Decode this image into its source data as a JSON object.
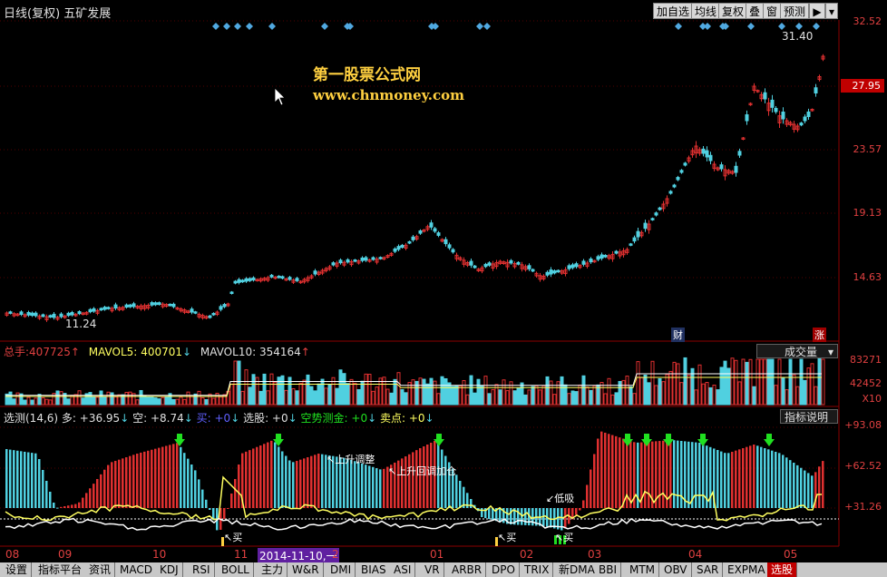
{
  "header": {
    "period_label": "日线(复权)",
    "stock_name": "五矿发展",
    "buttons": [
      "加自选",
      "均线",
      "复权",
      "叠",
      "窗",
      "预测"
    ]
  },
  "watermark": {
    "line1": "第一股票公式网",
    "line2": "www.chnmoney.com"
  },
  "main_chart": {
    "y_labels": [
      "32.52",
      "27.95",
      "23.57",
      "19.13",
      "14.63"
    ],
    "high_label": "31.40",
    "low_label": "11.24",
    "current_price_box": "27.95",
    "badge_cai": "财",
    "badge_zhang": "涨"
  },
  "volume": {
    "label_total": "总手:",
    "value_total": "407725",
    "label_mavol5": "MAVOL5:",
    "value_mavol5": "400701",
    "label_mavol10": "MAVOL10:",
    "value_mavol10": "354164",
    "dropdown": "成交量",
    "y_labels": [
      "83271",
      "42452",
      "X10"
    ]
  },
  "indicator": {
    "name": "选测(14,6)",
    "duo": "多: +36.95",
    "kong": "空: +8.74",
    "mai": "买: +0",
    "xuangu": "选股: +0",
    "kongshi": "空势测金: +0",
    "maidian": "卖点: +0",
    "explain": "指标说明",
    "y_labels": [
      "+93.08",
      "+62.52",
      "+31.26"
    ],
    "annotations": [
      "上升调整",
      "上升回调加仓",
      "低吸",
      "买",
      "买",
      "买"
    ]
  },
  "x_axis": {
    "months": [
      "08",
      "09",
      "10",
      "11",
      "01",
      "02",
      "03",
      "04",
      "05"
    ],
    "cursor_date": "2014-11-10,一",
    "after_cursor": "2"
  },
  "tabs": [
    "设置",
    "指标平台",
    "资讯",
    "MACD",
    "KDJ",
    "RSI",
    "BOLL",
    "主力",
    "W&R",
    "DMI",
    "BIAS",
    "ASI",
    "VR",
    "ARBR",
    "DPO",
    "TRIX",
    "新DMA",
    "BBI",
    "MTM",
    "OBV",
    "SAR",
    "EXPMA",
    "选股"
  ],
  "active_tab": "选股",
  "colors": {
    "up": "#e03030",
    "down": "#50d0e0",
    "yellow": "#ffff60",
    "label_red": "#e04040",
    "green_arrow": "#20e020"
  }
}
